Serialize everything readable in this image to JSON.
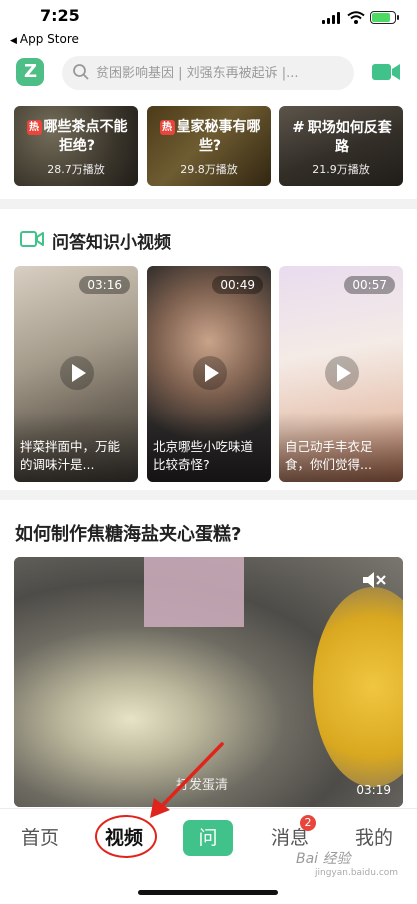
{
  "status_bar": {
    "time": "7:25",
    "back_label": "App Store"
  },
  "header": {
    "search_placeholder": "贫困影响基因 | 刘强东再被起诉 |..."
  },
  "hot_cards": [
    {
      "badge": "热",
      "title": "哪些茶点不能拒绝?",
      "plays": "28.7万播放"
    },
    {
      "badge": "热",
      "title": "皇家秘事有哪些?",
      "plays": "29.8万播放"
    },
    {
      "badge": "#",
      "title": "职场如何反套路",
      "plays": "21.9万播放"
    }
  ],
  "section": {
    "title": "问答知识小视频",
    "videos": [
      {
        "duration": "03:16",
        "caption": "拌菜拌面中，万能的调味汁是..."
      },
      {
        "duration": "00:49",
        "caption": "北京哪些小吃味道比较奇怪?"
      },
      {
        "duration": "00:57",
        "caption": "自己动手丰衣足食，你们觉得..."
      }
    ]
  },
  "article": {
    "title": "如何制作焦糖海盐夹心蛋糕?",
    "video_overlay_text": "打发蛋清",
    "duration": "03:19"
  },
  "tabs": {
    "home": "首页",
    "video": "视频",
    "ask": "问",
    "messages": "消息",
    "messages_badge": "2",
    "me": "我的"
  },
  "watermark": {
    "text": "Bai 经验",
    "sub": "jingyan.baidu.com"
  },
  "colors": {
    "brand_green": "#41c28a",
    "hot_red": "#e8453c",
    "annotation_red": "#e0241b"
  }
}
